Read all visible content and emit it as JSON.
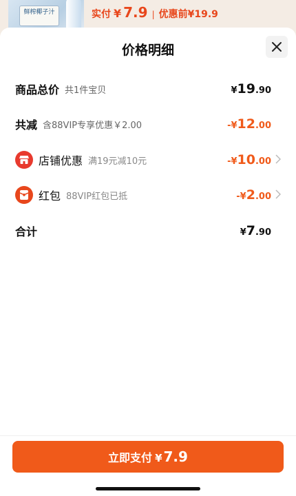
{
  "background": {
    "product_label": "鲜榨椰子汁",
    "price_label": "实付",
    "currency": "¥",
    "price": "7.9",
    "separator": "|",
    "original_price": "优惠前¥19.9"
  },
  "sheet": {
    "title": "价格明细",
    "close_icon": "close-icon"
  },
  "rows": {
    "goods_total": {
      "name": "商品总价",
      "desc": "共1件宝贝",
      "currency": "¥",
      "int": "19",
      "dec": ".90"
    },
    "total_discount": {
      "name": "共减",
      "desc": "含88VIP专享优惠￥2.00",
      "currency": "-¥",
      "int": "12",
      "dec": ".00"
    },
    "shop_discount": {
      "icon": "shop-icon",
      "name": "店铺优惠",
      "desc": "满19元减10元",
      "currency": "-¥",
      "int": "10",
      "dec": ".00"
    },
    "red_packet": {
      "icon": "red-packet-icon",
      "name": "红包",
      "desc": "88VIP红包已抵",
      "currency": "-¥",
      "int": "2",
      "dec": ".00"
    },
    "total": {
      "name": "合计",
      "currency": "¥",
      "int": "7",
      "dec": ".90"
    }
  },
  "footer": {
    "pay_label": "立即支付",
    "currency": "¥",
    "amount": "7.9"
  },
  "colors": {
    "accent": "#f05a1a",
    "text": "#111111",
    "muted": "#666666"
  }
}
